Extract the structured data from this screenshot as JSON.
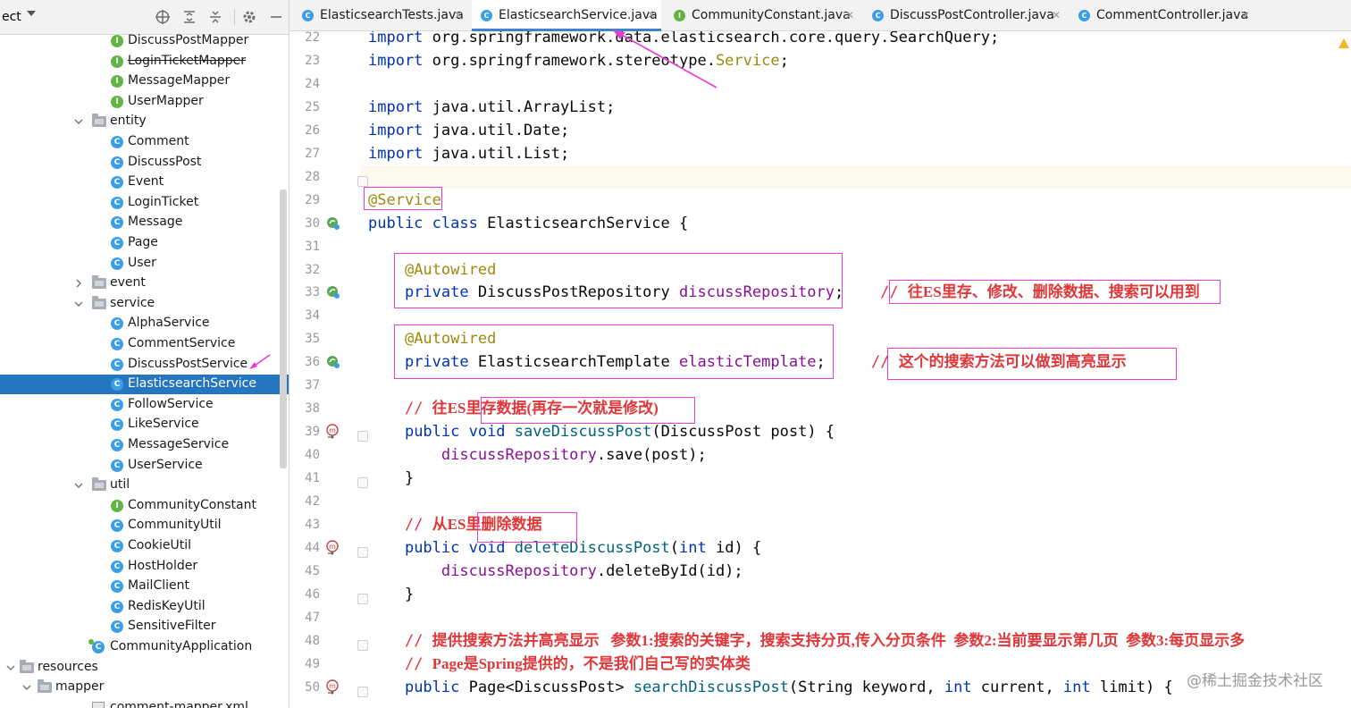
{
  "project_panel": {
    "title": "ect",
    "tree": [
      {
        "label": "DiscussPostMapper",
        "icon": "interface",
        "depth": 3,
        "strike": false
      },
      {
        "label": "LoginTicketMapper",
        "icon": "interface",
        "depth": 3,
        "strike": true
      },
      {
        "label": "MessageMapper",
        "icon": "interface",
        "depth": 3,
        "strike": false
      },
      {
        "label": "UserMapper",
        "icon": "interface",
        "depth": 3,
        "strike": false
      },
      {
        "label": "entity",
        "icon": "folder",
        "depth": 2,
        "arrow": "open"
      },
      {
        "label": "Comment",
        "icon": "class",
        "depth": 3
      },
      {
        "label": "DiscussPost",
        "icon": "class",
        "depth": 3
      },
      {
        "label": "Event",
        "icon": "class",
        "depth": 3
      },
      {
        "label": "LoginTicket",
        "icon": "class",
        "depth": 3
      },
      {
        "label": "Message",
        "icon": "class",
        "depth": 3
      },
      {
        "label": "Page",
        "icon": "class",
        "depth": 3
      },
      {
        "label": "User",
        "icon": "class",
        "depth": 3
      },
      {
        "label": "event",
        "icon": "folder",
        "depth": 2,
        "arrow": "closed"
      },
      {
        "label": "service",
        "icon": "folder",
        "depth": 2,
        "arrow": "open"
      },
      {
        "label": "AlphaService",
        "icon": "class",
        "depth": 3
      },
      {
        "label": "CommentService",
        "icon": "class",
        "depth": 3
      },
      {
        "label": "DiscussPostService",
        "icon": "class",
        "depth": 3
      },
      {
        "label": "ElasticsearchService",
        "icon": "class",
        "depth": 3,
        "selected": true
      },
      {
        "label": "FollowService",
        "icon": "class",
        "depth": 3
      },
      {
        "label": "LikeService",
        "icon": "class",
        "depth": 3
      },
      {
        "label": "MessageService",
        "icon": "class",
        "depth": 3
      },
      {
        "label": "UserService",
        "icon": "class",
        "depth": 3
      },
      {
        "label": "util",
        "icon": "folder",
        "depth": 2,
        "arrow": "open"
      },
      {
        "label": "CommunityConstant",
        "icon": "interface",
        "depth": 3
      },
      {
        "label": "CommunityUtil",
        "icon": "class",
        "depth": 3
      },
      {
        "label": "CookieUtil",
        "icon": "class",
        "depth": 3
      },
      {
        "label": "HostHolder",
        "icon": "class",
        "depth": 3
      },
      {
        "label": "MailClient",
        "icon": "class",
        "depth": 3
      },
      {
        "label": "RedisKeyUtil",
        "icon": "class",
        "depth": 3
      },
      {
        "label": "SensitiveFilter",
        "icon": "class",
        "depth": 3
      },
      {
        "label": "CommunityApplication",
        "icon": "app",
        "depth": 2
      },
      {
        "label": "resources",
        "icon": "folder",
        "depth": 0,
        "arrow": "open"
      },
      {
        "label": "mapper",
        "icon": "folder",
        "depth": 1,
        "arrow": "open"
      },
      {
        "label": "comment-mapper.xml",
        "icon": "xml",
        "depth": 2
      }
    ]
  },
  "tabs": [
    {
      "label": "ElasticsearchTests.java",
      "icon": "test-class",
      "active": false
    },
    {
      "label": "ElasticsearchService.java",
      "icon": "class",
      "active": true
    },
    {
      "label": "CommunityConstant.java",
      "icon": "interface",
      "active": false
    },
    {
      "label": "DiscussPostController.java",
      "icon": "class",
      "active": false
    },
    {
      "label": "CommentController.java",
      "icon": "class",
      "active": false
    }
  ],
  "editor": {
    "lines": [
      {
        "num": "22",
        "tokens": [
          [
            "kw",
            "import"
          ],
          [
            "plain",
            " org.springframework.data.elasticsearch.core.query.SearchQuery;"
          ]
        ]
      },
      {
        "num": "23",
        "tokens": [
          [
            "kw",
            "import"
          ],
          [
            "plain",
            " org.springframework.stereotype."
          ],
          [
            "anno",
            "Service"
          ],
          [
            "plain",
            ";"
          ]
        ]
      },
      {
        "num": "24",
        "tokens": []
      },
      {
        "num": "25",
        "tokens": [
          [
            "kw",
            "import"
          ],
          [
            "plain",
            " java.util.ArrayList;"
          ]
        ]
      },
      {
        "num": "26",
        "tokens": [
          [
            "kw",
            "import"
          ],
          [
            "plain",
            " java.util.Date;"
          ]
        ]
      },
      {
        "num": "27",
        "tokens": [
          [
            "kw",
            "import"
          ],
          [
            "plain",
            " java.util.List;"
          ]
        ]
      },
      {
        "num": "28",
        "tokens": []
      },
      {
        "num": "29",
        "tokens": [
          [
            "anno",
            "@Service"
          ]
        ]
      },
      {
        "num": "30",
        "tokens": [
          [
            "kw",
            "public class"
          ],
          [
            "plain",
            " ElasticsearchService {"
          ]
        ]
      },
      {
        "num": "31",
        "tokens": []
      },
      {
        "num": "32",
        "tokens": [
          [
            "plain",
            "    "
          ],
          [
            "anno",
            "@Autowired"
          ]
        ]
      },
      {
        "num": "33",
        "tokens": [
          [
            "plain",
            "    "
          ],
          [
            "kw",
            "private"
          ],
          [
            "plain",
            " DiscussPostRepository "
          ],
          [
            "fld",
            "discussRepository"
          ],
          [
            "plain",
            ";    "
          ],
          [
            "cmt-mono",
            "// "
          ],
          [
            "cmt",
            "往ES里存、修改、删除数据、搜索可以用到"
          ]
        ]
      },
      {
        "num": "34",
        "tokens": []
      },
      {
        "num": "35",
        "tokens": [
          [
            "plain",
            "    "
          ],
          [
            "anno",
            "@Autowired"
          ]
        ]
      },
      {
        "num": "36",
        "tokens": [
          [
            "plain",
            "    "
          ],
          [
            "kw",
            "private"
          ],
          [
            "plain",
            " ElasticsearchTemplate "
          ],
          [
            "fld",
            "elasticTemplate"
          ],
          [
            "plain",
            ";     "
          ],
          [
            "cmt-mono",
            "// "
          ],
          [
            "cmt",
            "这个的搜索方法可以做到高亮显示"
          ]
        ]
      },
      {
        "num": "37",
        "tokens": []
      },
      {
        "num": "38",
        "tokens": [
          [
            "plain",
            "    "
          ],
          [
            "cmt-mono",
            "// "
          ],
          [
            "cmt",
            "往ES里存数据(再存一次就是修改)"
          ]
        ]
      },
      {
        "num": "39",
        "tokens": [
          [
            "plain",
            "    "
          ],
          [
            "kw",
            "public void"
          ],
          [
            "plain",
            " "
          ],
          [
            "mth",
            "saveDiscussPost"
          ],
          [
            "plain",
            "(DiscussPost post) {"
          ]
        ]
      },
      {
        "num": "40",
        "tokens": [
          [
            "plain",
            "        "
          ],
          [
            "fld",
            "discussRepository"
          ],
          [
            "plain",
            ".save(post);"
          ]
        ]
      },
      {
        "num": "41",
        "tokens": [
          [
            "plain",
            "    }"
          ]
        ]
      },
      {
        "num": "42",
        "tokens": []
      },
      {
        "num": "43",
        "tokens": [
          [
            "plain",
            "    "
          ],
          [
            "cmt-mono",
            "// "
          ],
          [
            "cmt",
            "从ES里删除数据"
          ]
        ]
      },
      {
        "num": "44",
        "tokens": [
          [
            "plain",
            "    "
          ],
          [
            "kw",
            "public void"
          ],
          [
            "plain",
            " "
          ],
          [
            "mth",
            "deleteDiscussPost"
          ],
          [
            "plain",
            "("
          ],
          [
            "kw",
            "int"
          ],
          [
            "plain",
            " id) {"
          ]
        ]
      },
      {
        "num": "45",
        "tokens": [
          [
            "plain",
            "        "
          ],
          [
            "fld",
            "discussRepository"
          ],
          [
            "plain",
            ".deleteById(id);"
          ]
        ]
      },
      {
        "num": "46",
        "tokens": [
          [
            "plain",
            "    }"
          ]
        ]
      },
      {
        "num": "47",
        "tokens": []
      },
      {
        "num": "48",
        "tokens": [
          [
            "plain",
            "    "
          ],
          [
            "cmt-mono",
            "// "
          ],
          [
            "cmt",
            "提供搜索方法并高亮显示   参数1:搜索的关键字，搜索支持分页,传入分页条件  参数2:当前要显示第几页  参数3:每页显示多"
          ]
        ]
      },
      {
        "num": "49",
        "tokens": [
          [
            "plain",
            "    "
          ],
          [
            "cmt-mono",
            "// "
          ],
          [
            "cmt",
            "Page是Spring提供的，不是我们自己写的实体类"
          ]
        ]
      },
      {
        "num": "50",
        "tokens": [
          [
            "plain",
            "    "
          ],
          [
            "kw",
            "public"
          ],
          [
            "plain",
            " Page<DiscussPost> "
          ],
          [
            "mth",
            "searchDiscussPost"
          ],
          [
            "plain",
            "(String keyword, "
          ],
          [
            "kw",
            "int"
          ],
          [
            "plain",
            " current, "
          ],
          [
            "kw",
            "int"
          ],
          [
            "plain",
            " limit) {"
          ]
        ]
      }
    ]
  },
  "watermark": "@稀土掘金技术社区",
  "colors": {
    "selection": "#2675bf",
    "annotation_box": "#e63cd4",
    "comment": "#e0373a",
    "keyword": "#0033b3",
    "field": "#871094"
  }
}
